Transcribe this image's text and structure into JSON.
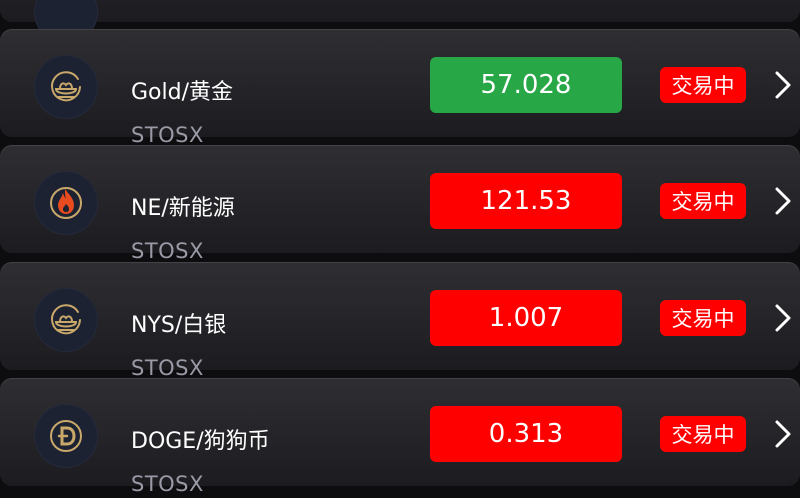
{
  "colors": {
    "card": "#26262b",
    "icon_bg": "#1d2233",
    "gold_accent": "#c9a86a",
    "up": "#27a745",
    "down": "#ff0000",
    "status_bg": "#ff0000",
    "subtext": "#9a9aa6"
  },
  "markets": [
    {
      "name": "Gold/黄金",
      "exchange": "STOSX",
      "price": "57.028",
      "trend": "up",
      "status": "交易中",
      "icon": "gold-ingot-icon"
    },
    {
      "name": "NE/新能源",
      "exchange": "STOSX",
      "price": "121.53",
      "trend": "down",
      "status": "交易中",
      "icon": "flame-icon"
    },
    {
      "name": "NYS/白银",
      "exchange": "STOSX",
      "price": "1.007",
      "trend": "down",
      "status": "交易中",
      "icon": "silver-ingot-icon"
    },
    {
      "name": "DOGE/狗狗币",
      "exchange": "STOSX",
      "price": "0.313",
      "trend": "down",
      "status": "交易中",
      "icon": "dogecoin-icon"
    }
  ]
}
